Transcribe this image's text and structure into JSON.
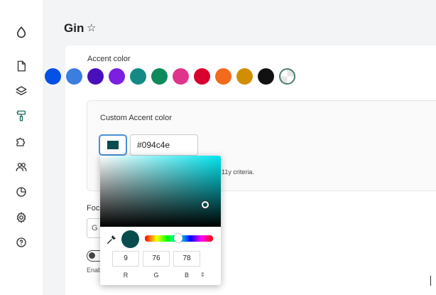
{
  "page": {
    "title": "Gin"
  },
  "toolbar": {
    "icons": [
      "drop-logo-icon",
      "file-icon",
      "layers-icon",
      "paint-roller-icon",
      "puzzle-icon",
      "people-icon",
      "chart-pie-icon",
      "gear-icon",
      "help-icon"
    ]
  },
  "accent": {
    "label": "Accent color",
    "swatches": [
      "#0550e6",
      "#3b7de0",
      "#4a0fbd",
      "#7b1fe0",
      "#148a86",
      "#0f8a5a",
      "#e0348c",
      "#d9002f",
      "#f26a1b",
      "#d18e00",
      "#111111"
    ]
  },
  "custom_accent": {
    "label": "Custom Accent color",
    "hex_value": "#094c4e",
    "note_fragment": "11y criteria."
  },
  "focus": {
    "label_fragment": "Foc",
    "select_fragment": "G"
  },
  "enable_fragment": "Enab",
  "picker": {
    "r": "9",
    "g": "76",
    "b": "78",
    "r_label": "R",
    "g_label": "G",
    "b_label": "B",
    "mode_toggle": "⇕"
  },
  "colors": {
    "accent": "#094c4e",
    "focus_ring": "#4a90d9"
  }
}
